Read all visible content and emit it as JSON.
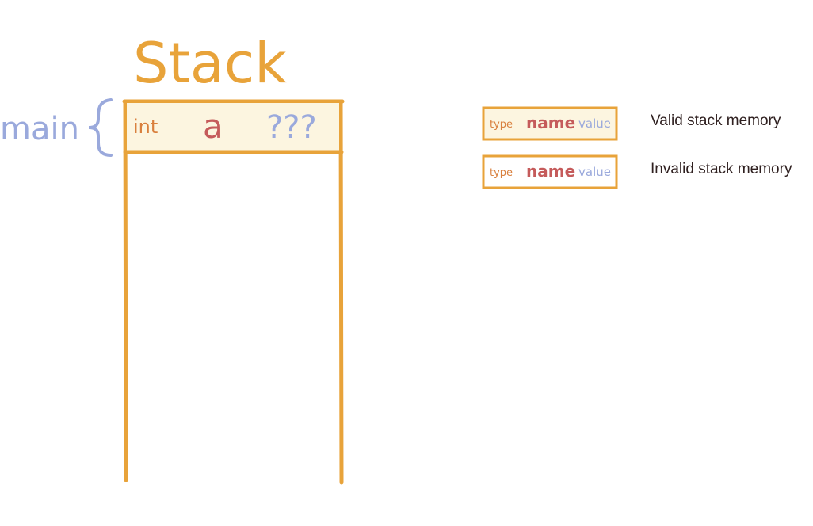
{
  "diagram": {
    "title": "Stack",
    "frame_label": "main",
    "frame": {
      "type": "int",
      "name": "a",
      "value": "???"
    },
    "colors": {
      "stack": "#E8A33A",
      "valid_fill": "#FCF5E0",
      "type": "#D9803E",
      "name": "#C55B5B",
      "value": "#9AA9DC",
      "label": "#9AA9DC"
    }
  },
  "legend": [
    {
      "type": "type",
      "name": "name",
      "value": "value",
      "description": "Valid stack memory"
    },
    {
      "type": "type",
      "name": "name",
      "value": "value",
      "description": "Invalid stack memory"
    }
  ]
}
